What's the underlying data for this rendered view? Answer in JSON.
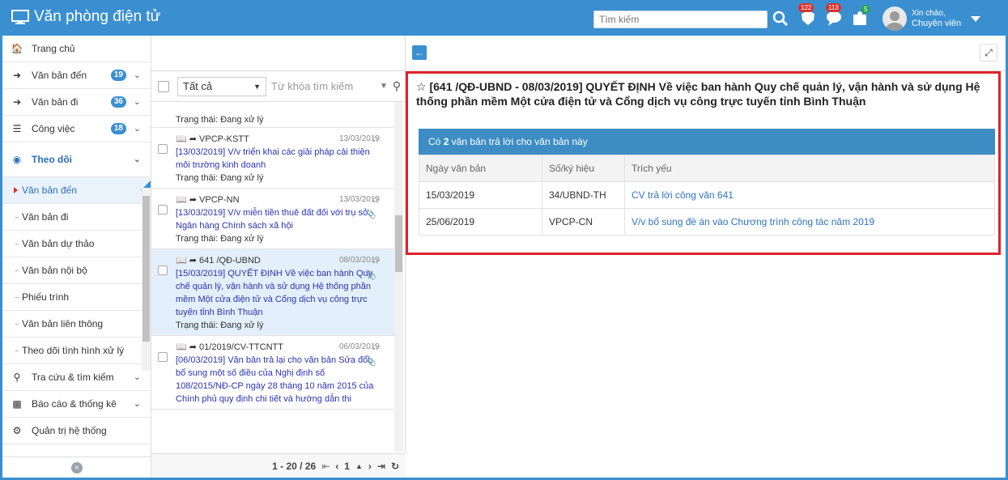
{
  "app": {
    "title": "Văn phòng điện tử"
  },
  "search": {
    "placeholder": "Tìm kiếm"
  },
  "header": {
    "badges": {
      "notify": "122",
      "messages": "113",
      "tasks": "5"
    },
    "greeting": "Xin chào,",
    "user_role": "Chuyên viên"
  },
  "sidebar": {
    "items": [
      {
        "label": "Trang chủ",
        "icon": "home-icon"
      },
      {
        "label": "Văn bản đến",
        "icon": "incoming-icon",
        "count": "19"
      },
      {
        "label": "Văn bản đi",
        "icon": "outgoing-icon",
        "count": "36"
      },
      {
        "label": "Công việc",
        "icon": "tasks-icon",
        "count": "18"
      },
      {
        "label": "Theo dõi",
        "icon": "eye-icon"
      }
    ],
    "sub_items": [
      {
        "label": "Văn bản đến"
      },
      {
        "label": "Văn bản đi"
      },
      {
        "label": "Văn bản dự thảo"
      },
      {
        "label": "Văn bản nội bộ"
      },
      {
        "label": "Phiếu trình"
      },
      {
        "label": "Văn bản liên thông"
      },
      {
        "label": "Theo dõi tình hình xử lý"
      }
    ],
    "bottom_items": [
      {
        "label": "Tra cứu & tìm kiếm",
        "icon": "search-icon"
      },
      {
        "label": "Báo cáo & thống kê",
        "icon": "bar-chart-icon"
      },
      {
        "label": "Quản trị hệ thống",
        "icon": "gears-icon"
      }
    ]
  },
  "list": {
    "filter_all": "Tất cả",
    "keyword_placeholder": "Từ khóa tìm kiếm",
    "status_prefix": "Trạng thái: Đang xử lý",
    "docs": [
      {
        "code": "VPCP-KSTT",
        "date": "13/03/2019",
        "title": "[13/03/2019] V/v triển khai các giải pháp cải thiện môi trường kinh doanh",
        "status": "Trạng thái: Đang xử lý"
      },
      {
        "code": "VPCP-NN",
        "date": "13/03/2019",
        "title": "[13/03/2019] V/v miễn tiền thuê đất đối với trụ sở Ngân hàng Chính sách xã hội",
        "status": "Trạng thái: Đang xử lý"
      },
      {
        "code": "641 /QĐ-UBND",
        "date": "08/03/2019",
        "title": "[15/03/2019] QUYẾT ĐỊNH Về việc ban hành Quy chế quản lý, vận hành và sử dụng Hệ thống phần mềm Một cửa điện tử và Cổng dịch vụ công trực tuyến tỉnh Bình Thuận",
        "status": "Trạng thái: Đang xử lý"
      },
      {
        "code": "01/2019/CV-TTCNTT",
        "date": "06/03/2019",
        "title": "[06/03/2019] Văn bản trả lại cho văn bản Sửa đổi, bổ sung một số điều của Nghị định số 108/2015/NĐ-CP ngày 28 tháng 10 năm 2015 của Chính phủ quy định chi tiết và hướng dẫn thi",
        "status": ""
      }
    ],
    "pager": {
      "range": "1 - 20 / 26",
      "page": "1"
    }
  },
  "detail": {
    "title": "[641 /QĐ-UBND - 08/03/2019] QUYẾT ĐỊNH Về việc ban hành Quy chế quản lý, vận hành và sử dụng Hệ thống phần mềm Một cửa điện tử và Cổng dịch vụ công trực tuyến tỉnh Bình Thuận",
    "reply_prefix": "Có",
    "reply_count": "2",
    "reply_suffix": "văn bản trả lời cho văn bản này",
    "columns": [
      "Ngày văn bản",
      "Số/ký hiệu",
      "Trích yếu"
    ],
    "rows": [
      [
        "15/03/2019",
        "34/UBND-TH",
        "CV trả lời công văn 641"
      ],
      [
        "25/06/2019",
        "VPCP-CN",
        "V/v bổ sung đề án vào Chương trình công tác năm 2019"
      ]
    ]
  }
}
